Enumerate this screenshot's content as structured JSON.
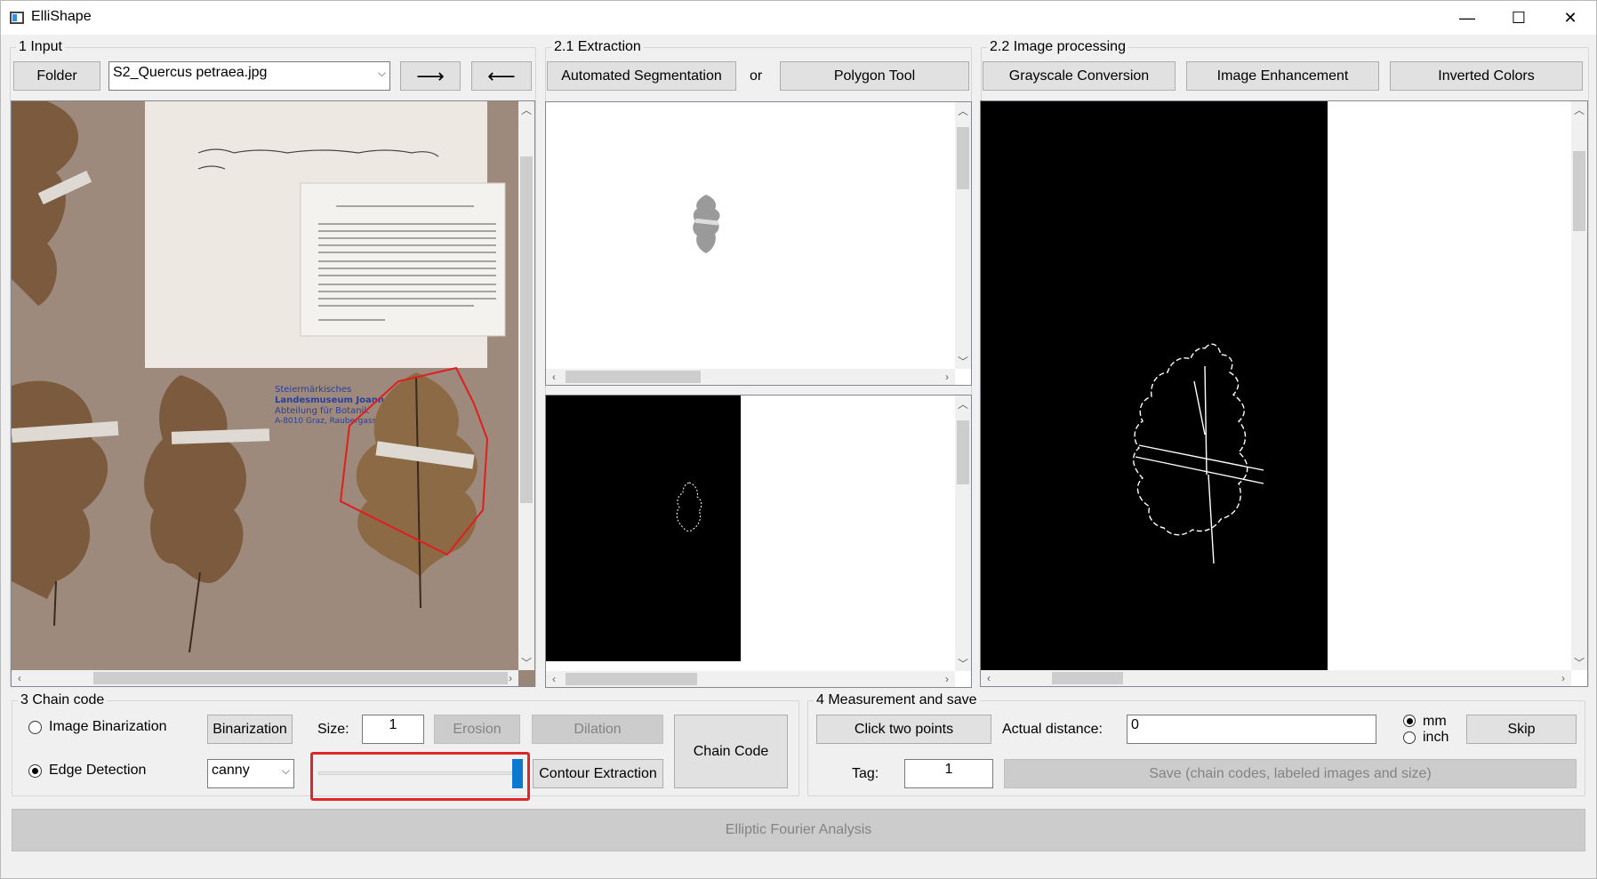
{
  "window": {
    "title": "ElliShape",
    "min": "—",
    "max": "☐",
    "close": "✕"
  },
  "input": {
    "title": "1 Input",
    "folder_label": "Folder",
    "file_value": "S2_Quercus petraea.jpg",
    "next_label": "⟶",
    "prev_label": "⟵"
  },
  "extraction": {
    "title": "2.1 Extraction",
    "auto_label": "Automated Segmentation",
    "or_label": "or",
    "polygon_label": "Polygon Tool"
  },
  "processing": {
    "title": "2.2 Image processing",
    "gray_label": "Grayscale Conversion",
    "enhance_label": "Image Enhancement",
    "invert_label": "Inverted Colors"
  },
  "chain": {
    "title": "3 Chain code",
    "binarization_radio": "Image Binarization",
    "binarization_btn": "Binarization",
    "size_label": "Size:",
    "size_value": "1",
    "erosion_label": "Erosion",
    "dilation_label": "Dilation",
    "chain_code_label": "Chain Code",
    "edge_radio": "Edge Detection",
    "edge_method": "canny",
    "slider_value": 1.0,
    "contour_label": "Contour Extraction",
    "selected_mode": "Edge Detection"
  },
  "measurement": {
    "title": "4 Measurement and save",
    "click_points_label": "Click two points",
    "actual_distance_label": "Actual distance:",
    "actual_distance_value": "0",
    "unit_mm": "mm",
    "unit_inch": "inch",
    "selected_unit": "mm",
    "skip_label": "Skip",
    "tag_label": "Tag:",
    "tag_value": "1",
    "save_label": "Save (chain codes, labeled images and size)"
  },
  "efa_label": "Elliptic Fourier Analysis",
  "specimen_label": {
    "line1": "Steiermärkisches",
    "line2": "Landesmuseum Joanneum",
    "line3": "Abteilung für Botanik",
    "line4": "A-8010 Graz, Raubergasse 10"
  },
  "colors": {
    "highlight": "#e0262a",
    "slider_thumb": "#0b79d0",
    "polygon": "#e01e1e"
  }
}
